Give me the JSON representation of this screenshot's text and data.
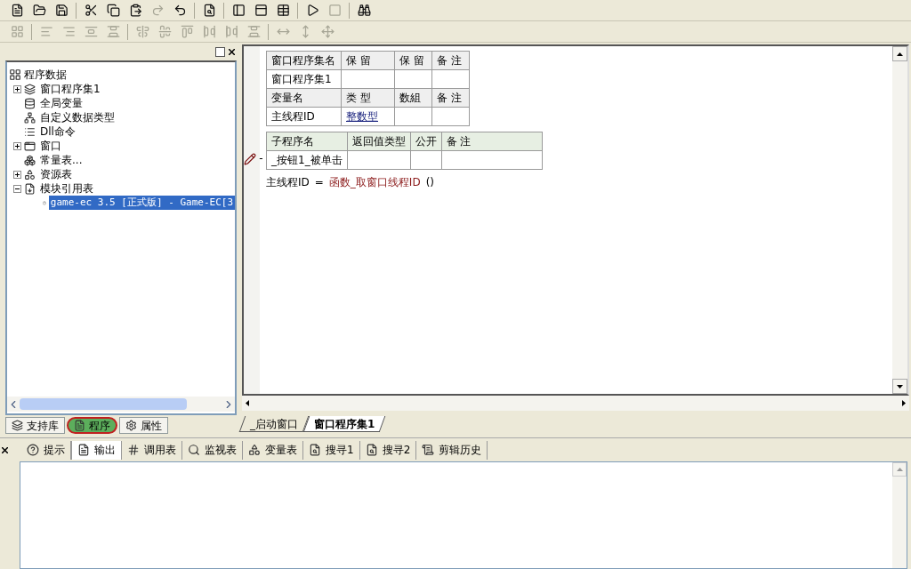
{
  "toolbar_1": [
    {
      "disabled": false
    },
    {
      "disabled": false
    },
    {
      "disabled": false
    },
    {
      "disabled": false
    },
    {
      "disabled": false
    },
    {
      "disabled": false
    },
    {
      "disabled": true
    },
    {
      "disabled": false
    },
    {
      "disabled": false
    },
    {
      "disabled": false
    },
    {
      "disabled": false
    },
    {
      "disabled": false
    },
    {
      "disabled": false
    },
    {
      "disabled": true
    },
    {
      "disabled": false
    }
  ],
  "toolbar_2": [
    {
      "disabled": true
    },
    {
      "disabled": true
    },
    {
      "disabled": true
    },
    {
      "disabled": true
    },
    {
      "disabled": true
    },
    {
      "disabled": true
    },
    {
      "disabled": true
    },
    {
      "disabled": true
    },
    {
      "disabled": true
    },
    {
      "disabled": true
    },
    {
      "disabled": true
    },
    {
      "disabled": true
    },
    {
      "disabled": true
    },
    {
      "disabled": true
    }
  ],
  "tree": {
    "label": "程序数据",
    "children": [
      {
        "label": "窗口程序集1",
        "expanded": false,
        "selected": false
      },
      {
        "label": "全局变量",
        "selected": false
      },
      {
        "label": "自定义数据类型",
        "selected": false
      },
      {
        "label": "Dll命令",
        "selected": false
      },
      {
        "label": "窗口",
        "expanded": false,
        "selected": false
      },
      {
        "label": "常量表...",
        "selected": false
      },
      {
        "label": "资源表",
        "expanded": false,
        "selected": false
      },
      {
        "label": "模块引用表",
        "expanded": true,
        "selected": false,
        "children": [
          {
            "label": "game-ec 3.5 [正式版] - Game-EC[3",
            "selected": true
          }
        ]
      }
    ]
  },
  "left_tabs": [
    {
      "label": "支持库",
      "selected": false
    },
    {
      "label": "程序",
      "selected": true
    },
    {
      "label": "属性",
      "selected": false
    }
  ],
  "assembly_table": {
    "columns": [
      "窗口程序集名",
      "保 留",
      "保 留",
      "备 注"
    ],
    "rows": [
      [
        "窗口程序集1",
        "",
        "",
        ""
      ]
    ]
  },
  "variable_table": {
    "columns": [
      "变量名",
      "类 型",
      "数組",
      "备 注"
    ],
    "rows": [
      [
        "主线程ID",
        "整数型",
        "",
        ""
      ]
    ]
  },
  "sub_table": {
    "columns": [
      "子程序名",
      "返回值类型",
      "公开",
      "备 注"
    ],
    "rows": [
      [
        "_按钮1_被单击",
        "",
        "",
        ""
      ]
    ],
    "fold": "-"
  },
  "code_line": {
    "target": "主线程ID",
    "operator": "=",
    "call": "函数_取窗口线程ID",
    "args": "()"
  },
  "editor_tabs": [
    {
      "label": "_启动窗口",
      "selected": false
    },
    {
      "label": "窗口程序集1",
      "selected": true
    }
  ],
  "bottom_tabs": [
    {
      "label": "提示",
      "selected": false
    },
    {
      "label": "输出",
      "selected": true
    },
    {
      "label": "调用表",
      "selected": false
    },
    {
      "label": "监视表",
      "selected": false
    },
    {
      "label": "变量表",
      "selected": false
    },
    {
      "label": "搜寻1",
      "selected": false
    },
    {
      "label": "搜寻2",
      "selected": false
    },
    {
      "label": "剪辑历史",
      "selected": false
    }
  ]
}
